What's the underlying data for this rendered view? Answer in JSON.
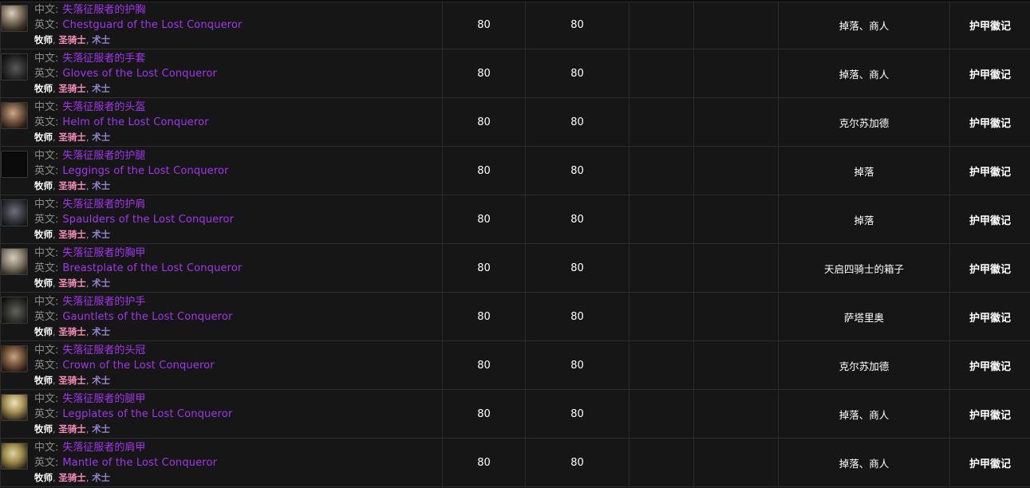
{
  "table": {
    "columns": [
      {
        "key": "item",
        "label": ""
      },
      {
        "key": "ilvl",
        "label": ""
      },
      {
        "key": "level",
        "label": ""
      },
      {
        "key": "c",
        "label": ""
      },
      {
        "key": "d",
        "label": ""
      },
      {
        "key": "source",
        "label": ""
      },
      {
        "key": "cost",
        "label": ""
      }
    ],
    "labels": {
      "cn": "中文:",
      "en": "英文:",
      "separator": ", "
    },
    "classes": {
      "priest": "牧师",
      "paladin": "圣骑士",
      "warlock": "术士"
    },
    "colors": {
      "epic": "#a335ee",
      "priest": "#ffffff",
      "paladin": "#f58cba",
      "warlock": "#9482c9",
      "label": "#8a8a8a",
      "background": "#161616",
      "border": "#2e2e2e"
    },
    "rows": [
      {
        "icon": "chest-armor-icon",
        "name_cn": "失落征服者的护胸",
        "name_en": "Chestguard of the Lost Conqueror",
        "ilvl": "80",
        "level": "80",
        "c": "",
        "d": "",
        "source": "掉落、商人",
        "cost": "护甲徽记"
      },
      {
        "icon": "gloves-armor-icon",
        "name_cn": "失落征服者的手套",
        "name_en": "Gloves of the Lost Conqueror",
        "ilvl": "80",
        "level": "80",
        "c": "",
        "d": "",
        "source": "掉落、商人",
        "cost": "护甲徽记"
      },
      {
        "icon": "helm-armor-icon",
        "name_cn": "失落征服者的头盔",
        "name_en": "Helm of the Lost Conqueror",
        "ilvl": "80",
        "level": "80",
        "c": "",
        "d": "",
        "source": "克尔苏加德",
        "cost": "护甲徽记"
      },
      {
        "icon": "leggings-armor-icon",
        "name_cn": "失落征服者的护腿",
        "name_en": "Leggings of the Lost Conqueror",
        "ilvl": "80",
        "level": "80",
        "c": "",
        "d": "",
        "source": "掉落",
        "cost": "护甲徽记"
      },
      {
        "icon": "spaulders-armor-icon",
        "name_cn": "失落征服者的护肩",
        "name_en": "Spaulders of the Lost Conqueror",
        "ilvl": "80",
        "level": "80",
        "c": "",
        "d": "",
        "source": "掉落",
        "cost": "护甲徽记"
      },
      {
        "icon": "breastplate-armor-icon",
        "name_cn": "失落征服者的胸甲",
        "name_en": "Breastplate of the Lost Conqueror",
        "ilvl": "80",
        "level": "80",
        "c": "",
        "d": "",
        "source": "天启四骑士的箱子",
        "cost": "护甲徽记"
      },
      {
        "icon": "gauntlets-armor-icon",
        "name_cn": "失落征服者的护手",
        "name_en": "Gauntlets of the Lost Conqueror",
        "ilvl": "80",
        "level": "80",
        "c": "",
        "d": "",
        "source": "萨塔里奥",
        "cost": "护甲徽记"
      },
      {
        "icon": "crown-armor-icon",
        "name_cn": "失落征服者的头冠",
        "name_en": "Crown of the Lost Conqueror",
        "ilvl": "80",
        "level": "80",
        "c": "",
        "d": "",
        "source": "克尔苏加德",
        "cost": "护甲徽记"
      },
      {
        "icon": "legplates-armor-icon",
        "name_cn": "失落征服者的腿甲",
        "name_en": "Legplates of the Lost Conqueror",
        "ilvl": "80",
        "level": "80",
        "c": "",
        "d": "",
        "source": "掉落、商人",
        "cost": "护甲徽记"
      },
      {
        "icon": "mantle-armor-icon",
        "name_cn": "失落征服者的肩甲",
        "name_en": "Mantle of the Lost Conqueror",
        "ilvl": "80",
        "level": "80",
        "c": "",
        "d": "",
        "source": "掉落、商人",
        "cost": "护甲徽记"
      }
    ]
  }
}
